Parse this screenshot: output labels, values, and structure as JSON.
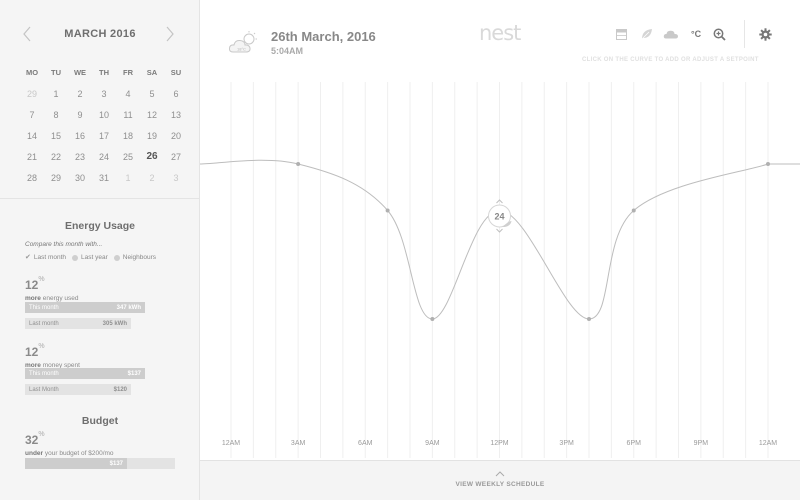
{
  "calendar": {
    "month_label": "MARCH 2016",
    "weekdays": [
      "MO",
      "TU",
      "WE",
      "TH",
      "FR",
      "SA",
      "SU"
    ],
    "weeks": [
      [
        {
          "d": "29",
          "m": true
        },
        {
          "d": "1"
        },
        {
          "d": "2"
        },
        {
          "d": "3"
        },
        {
          "d": "4"
        },
        {
          "d": "5"
        },
        {
          "d": "6"
        }
      ],
      [
        {
          "d": "7"
        },
        {
          "d": "8"
        },
        {
          "d": "9"
        },
        {
          "d": "10"
        },
        {
          "d": "11"
        },
        {
          "d": "12"
        },
        {
          "d": "13"
        }
      ],
      [
        {
          "d": "14"
        },
        {
          "d": "15"
        },
        {
          "d": "16"
        },
        {
          "d": "17"
        },
        {
          "d": "18"
        },
        {
          "d": "19"
        },
        {
          "d": "20"
        }
      ],
      [
        {
          "d": "21"
        },
        {
          "d": "22"
        },
        {
          "d": "23"
        },
        {
          "d": "24"
        },
        {
          "d": "25"
        },
        {
          "d": "26",
          "today": true
        },
        {
          "d": "27"
        }
      ],
      [
        {
          "d": "28"
        },
        {
          "d": "29"
        },
        {
          "d": "30"
        },
        {
          "d": "31"
        },
        {
          "d": "1",
          "m": true
        },
        {
          "d": "2",
          "m": true
        },
        {
          "d": "3",
          "m": true
        }
      ]
    ]
  },
  "energy": {
    "title": "Energy Usage",
    "compare_label": "Compare this month with...",
    "options": [
      {
        "label": "Last month",
        "checked": true
      },
      {
        "label": "Last year",
        "checked": false
      },
      {
        "label": "Neighbours",
        "checked": false
      }
    ],
    "energy_stat": {
      "value": "12",
      "unit": "%",
      "bold": "more",
      "rest": "energy used"
    },
    "energy_bars": [
      {
        "label": "This month",
        "value": "347 kWh",
        "style": "dark",
        "fraction": 1.0
      },
      {
        "label": "Last month",
        "value": "305 kWh",
        "style": "light",
        "fraction": 0.88
      }
    ],
    "money_stat": {
      "value": "12",
      "unit": "%",
      "bold": "more",
      "rest": "money spent"
    },
    "money_bars": [
      {
        "label": "This month",
        "value": "$137",
        "style": "dark",
        "fraction": 1.0
      },
      {
        "label": "Last Month",
        "value": "$120",
        "style": "light",
        "fraction": 0.88
      }
    ]
  },
  "budget": {
    "title": "Budget",
    "stat": {
      "value": "32",
      "unit": "%",
      "bold": "under",
      "rest": "your budget of $200/mo"
    },
    "bar": {
      "value": "$137",
      "fraction": 0.68
    }
  },
  "header": {
    "weather_icon": "cloud-sun-icon",
    "weather_temp": "18°C",
    "date": "26th March, 2016",
    "time": "5:04AM",
    "logo": "nest",
    "unit_label": "°C",
    "hint": "CLICK ON THE CURVE TO ADD OR ADJUST A SETPOINT"
  },
  "chart_data": {
    "type": "line",
    "x_tick_labels": [
      "12AM",
      "3AM",
      "6AM",
      "9AM",
      "12PM",
      "3PM",
      "6PM",
      "9PM",
      "12AM"
    ],
    "x_range_hours": [
      0,
      24
    ],
    "series": [
      {
        "setpoints": [
          {
            "hour": 3.0,
            "level": 0.0
          },
          {
            "hour": 7.0,
            "level": 0.3
          },
          {
            "hour": 9.0,
            "level": 1.0
          },
          {
            "hour": 12.0,
            "level": 0.3
          },
          {
            "hour": 16.0,
            "level": 1.0
          },
          {
            "hour": 18.0,
            "level": 0.3
          },
          {
            "hour": 24.0,
            "level": 0.0
          }
        ]
      }
    ],
    "active_setpoint": {
      "hour": 12.0,
      "label": "24"
    },
    "vertical_gridlines_per_hour": 1,
    "grid": true
  },
  "footer": {
    "label": "VIEW WEEKLY SCHEDULE"
  },
  "colors": {
    "curve": "#bdbdbd",
    "grid": "#efefef",
    "sidebar": "#f5f5f5",
    "footer": "#f4f4f4"
  }
}
